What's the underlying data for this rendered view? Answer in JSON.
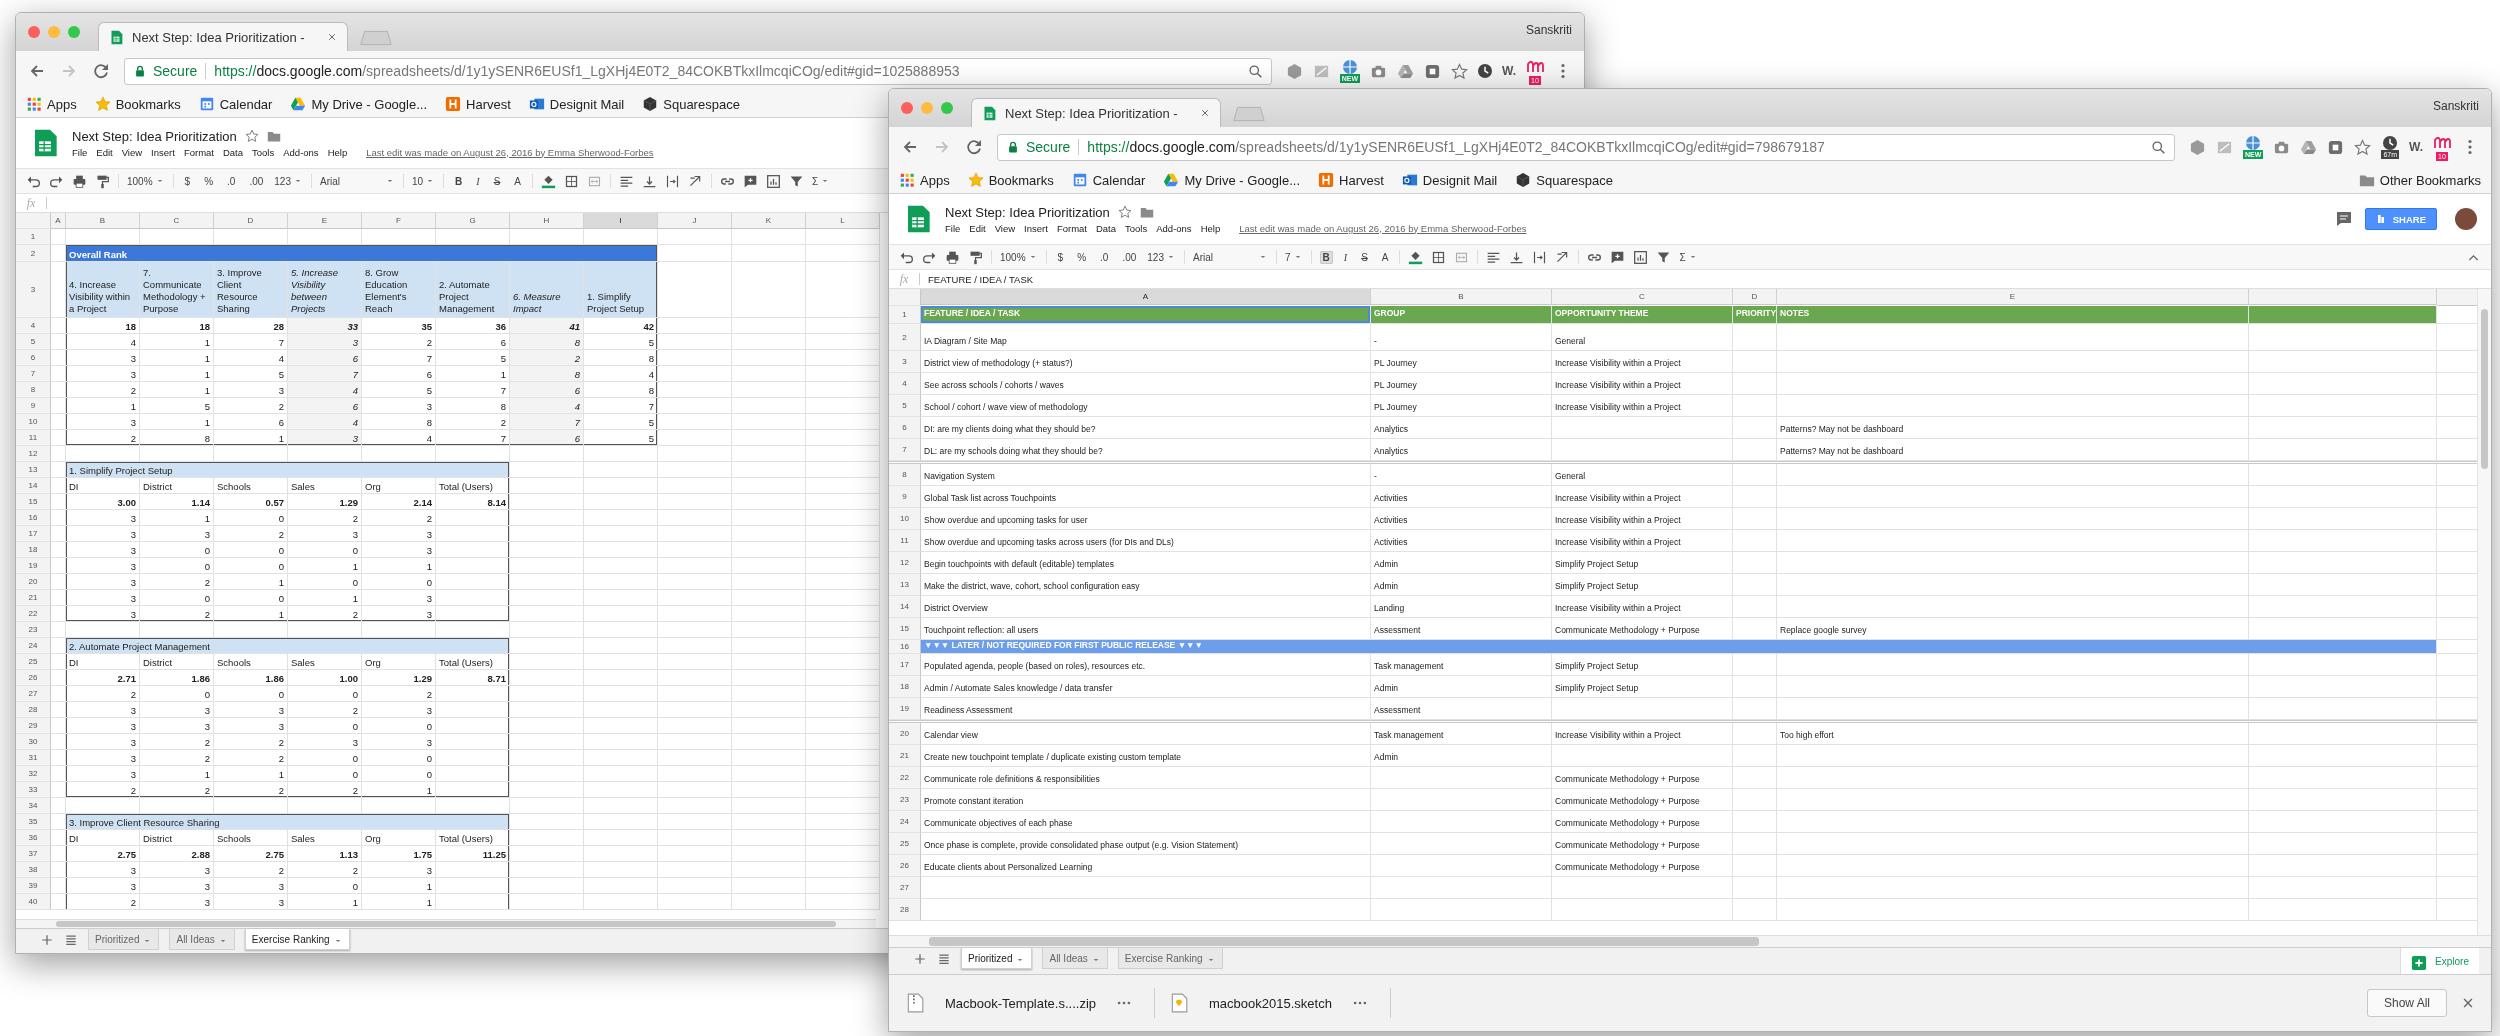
{
  "back_window": {
    "tab_title": "Next Step: Idea Prioritization -",
    "profile": "Sanskriti",
    "address": {
      "secure": "Secure",
      "scheme": "https://",
      "host": "docs.google.com",
      "path": "/spreadsheets/d/1y1ySENR6EUSf1_LgXHj4E0T2_84COKBTkxIlmcqiCOg/edit#gid=1025888953"
    },
    "extensions": {
      "new_badge": "NEW",
      "w_label": "W.",
      "m_badge": "10"
    },
    "bookmarks": [
      {
        "label": "Apps",
        "kind": "apps"
      },
      {
        "label": "Bookmarks",
        "kind": "star"
      },
      {
        "label": "Calendar",
        "kind": "calendar"
      },
      {
        "label": "My Drive - Google...",
        "kind": "drive"
      },
      {
        "label": "Harvest",
        "kind": "harvest"
      },
      {
        "label": "Designit Mail",
        "kind": "mail"
      },
      {
        "label": "Squarespace",
        "kind": "cube"
      }
    ],
    "doc": {
      "title": "Next Step: Idea Prioritization",
      "menus": [
        "File",
        "Edit",
        "View",
        "Insert",
        "Format",
        "Data",
        "Tools",
        "Add-ons",
        "Help"
      ],
      "last_edit": "Last edit was made on August 26, 2016 by Emma Sherwood-Forbes"
    },
    "toolbar": {
      "zoom": "100%",
      "currency": "$",
      "percent": "%",
      "decimals_less": ".0",
      "decimals_more": ".00",
      "number_format": "123",
      "font": "Arial",
      "font_size": "10",
      "bold": "B",
      "bold_active": false,
      "italic": "I",
      "strike": "S",
      "text_color": "A",
      "functions": "Σ"
    },
    "fx_label": "fx",
    "sheet": {
      "columns": [
        {
          "letter": "A",
          "selected": false
        },
        {
          "letter": "B",
          "selected": false
        },
        {
          "letter": "C",
          "selected": false
        },
        {
          "letter": "D",
          "selected": false
        },
        {
          "letter": "E",
          "selected": false
        },
        {
          "letter": "F",
          "selected": false
        },
        {
          "letter": "G",
          "selected": false
        },
        {
          "letter": "H",
          "selected": false
        },
        {
          "letter": "I",
          "selected": true
        },
        {
          "letter": "J",
          "selected": false
        },
        {
          "letter": "K",
          "selected": false
        },
        {
          "letter": "L",
          "selected": false
        }
      ],
      "row_numbers": [
        "1",
        "2",
        "3",
        "4",
        "5",
        "6",
        "7",
        "8",
        "9",
        "10",
        "11",
        "12",
        "13",
        "14",
        "15",
        "16",
        "17",
        "18",
        "19",
        "20",
        "21",
        "22",
        "23",
        "24",
        "25",
        "26",
        "27",
        "28",
        "29",
        "30",
        "31",
        "32",
        "33",
        "34",
        "35",
        "36",
        "37",
        "38",
        "39",
        "40"
      ],
      "rank_table": {
        "title": "Overall Rank",
        "columns": [
          {
            "heading": "4. Increase Visibility within a Project",
            "italic": false,
            "total": "18",
            "scores": [
              "4",
              "3",
              "3",
              "2",
              "1",
              "3",
              "2"
            ]
          },
          {
            "heading": "7. Communicate Methodology + Purpose",
            "italic": false,
            "total": "18",
            "scores": [
              "1",
              "1",
              "1",
              "1",
              "5",
              "1",
              "8"
            ]
          },
          {
            "heading": "3. Improve Client Resource Sharing",
            "italic": false,
            "total": "28",
            "scores": [
              "7",
              "4",
              "5",
              "3",
              "2",
              "6",
              "1"
            ]
          },
          {
            "heading": "5. Increase Visibility between Projects",
            "italic": true,
            "total": "33",
            "scores": [
              "3",
              "6",
              "7",
              "4",
              "6",
              "4",
              "3"
            ]
          },
          {
            "heading": "8. Grow Education Element's Reach",
            "italic": false,
            "total": "35",
            "scores": [
              "2",
              "7",
              "6",
              "5",
              "3",
              "8",
              "4"
            ]
          },
          {
            "heading": "2. Automate Project Management",
            "italic": false,
            "total": "36",
            "scores": [
              "6",
              "5",
              "1",
              "7",
              "8",
              "2",
              "7"
            ]
          },
          {
            "heading": "6. Measure Impact",
            "italic": true,
            "total": "41",
            "scores": [
              "8",
              "2",
              "8",
              "6",
              "4",
              "7",
              "6"
            ]
          },
          {
            "heading": "1. Simplify Project Setup",
            "italic": false,
            "total": "42",
            "scores": [
              "5",
              "8",
              "4",
              "8",
              "7",
              "5",
              "5"
            ]
          }
        ]
      },
      "group_tables": [
        {
          "title": "1. Simplify Project Setup",
          "headings": [
            "DI",
            "District",
            "Schools",
            "Sales",
            "Org",
            "Total (Users)"
          ],
          "averages": [
            "3.00",
            "1.14",
            "0.57",
            "1.29",
            "2.14",
            "8.14"
          ],
          "rows": [
            [
              "3",
              "1",
              "0",
              "2",
              "2"
            ],
            [
              "3",
              "3",
              "2",
              "3",
              "3"
            ],
            [
              "3",
              "0",
              "0",
              "0",
              "3"
            ],
            [
              "3",
              "0",
              "0",
              "1",
              "1"
            ],
            [
              "3",
              "2",
              "1",
              "0",
              "0"
            ],
            [
              "3",
              "0",
              "0",
              "1",
              "3"
            ],
            [
              "3",
              "2",
              "1",
              "2",
              "3"
            ]
          ]
        },
        {
          "title": "2. Automate Project Management",
          "headings": [
            "DI",
            "District",
            "Schools",
            "Sales",
            "Org",
            "Total (Users)"
          ],
          "averages": [
            "2.71",
            "1.86",
            "1.86",
            "1.00",
            "1.29",
            "8.71"
          ],
          "rows": [
            [
              "2",
              "0",
              "0",
              "0",
              "2"
            ],
            [
              "3",
              "3",
              "3",
              "2",
              "3"
            ],
            [
              "3",
              "3",
              "3",
              "0",
              "0"
            ],
            [
              "3",
              "2",
              "2",
              "3",
              "3"
            ],
            [
              "3",
              "2",
              "2",
              "0",
              "0"
            ],
            [
              "3",
              "1",
              "1",
              "0",
              "0"
            ],
            [
              "2",
              "2",
              "2",
              "2",
              "1"
            ]
          ]
        },
        {
          "title": "3. Improve Client Resource Sharing",
          "headings": [
            "DI",
            "District",
            "Schools",
            "Sales",
            "Org",
            "Total (Users)"
          ],
          "averages": [
            "2.75",
            "2.88",
            "2.75",
            "1.13",
            "1.75",
            "11.25"
          ],
          "rows": [
            [
              "3",
              "3",
              "2",
              "2",
              "3"
            ],
            [
              "3",
              "3",
              "3",
              "0",
              "1"
            ],
            [
              "2",
              "3",
              "3",
              "1",
              "1"
            ]
          ]
        }
      ]
    },
    "sheet_tabs": [
      {
        "label": "Prioritized",
        "selected": false
      },
      {
        "label": "All Ideas",
        "selected": false
      },
      {
        "label": "Exercise Ranking",
        "selected": true
      }
    ]
  },
  "front_window": {
    "tab_title": "Next Step: Idea Prioritization -",
    "profile": "Sanskriti",
    "address": {
      "secure": "Secure",
      "scheme": "https://",
      "host": "docs.google.com",
      "path": "/spreadsheets/d/1y1ySENR6EUSf1_LgXHj4E0T2_84COKBTkxIlmcqiCOg/edit#gid=798679187"
    },
    "extensions": {
      "new_badge": "NEW",
      "clock_badge": "67m",
      "w_label": "W.",
      "m_badge": "10"
    },
    "bookmarks": [
      {
        "label": "Apps",
        "kind": "apps"
      },
      {
        "label": "Bookmarks",
        "kind": "star"
      },
      {
        "label": "Calendar",
        "kind": "calendar"
      },
      {
        "label": "My Drive - Google...",
        "kind": "drive"
      },
      {
        "label": "Harvest",
        "kind": "harvest"
      },
      {
        "label": "Designit Mail",
        "kind": "mail"
      },
      {
        "label": "Squarespace",
        "kind": "cube"
      }
    ],
    "other_bookmarks": "Other Bookmarks",
    "doc": {
      "title": "Next Step: Idea Prioritization",
      "menus": [
        "File",
        "Edit",
        "View",
        "Insert",
        "Format",
        "Data",
        "Tools",
        "Add-ons",
        "Help"
      ],
      "last_edit": "Last edit was made on August 26, 2016 by Emma Sherwood-Forbes",
      "share": "SHARE"
    },
    "toolbar": {
      "zoom": "100%",
      "currency": "$",
      "percent": "%",
      "decimals_less": ".0",
      "decimals_more": ".00",
      "number_format": "123",
      "font": "Arial",
      "font_size": "7",
      "bold": "B",
      "bold_active": true,
      "italic": "I",
      "strike": "S",
      "text_color": "A",
      "functions": "Σ"
    },
    "fx_label": "fx",
    "formula": "FEATURE / IDEA / TASK",
    "sheet": {
      "columns": [
        {
          "letter": "A",
          "selected": true
        },
        {
          "letter": "B",
          "selected": false
        },
        {
          "letter": "C",
          "selected": false
        },
        {
          "letter": "D",
          "selected": false
        },
        {
          "letter": "E",
          "selected": false
        }
      ],
      "rows": [
        {
          "number": "1",
          "kind": "header",
          "section_start": false,
          "cells": [
            "FEATURE / IDEA / TASK",
            "GROUP",
            "OPPORTUNITY THEME",
            "PRIORITY",
            "NOTES"
          ]
        },
        {
          "number": "2",
          "kind": "item",
          "section_start": false,
          "task": "IA Diagram / Site Map",
          "group": "-",
          "theme": "General"
        },
        {
          "number": "3",
          "kind": "item",
          "section_start": false,
          "task": "District view of methodology (+ status?)",
          "group": "PL Journey",
          "theme": "Increase Visibility within a Project"
        },
        {
          "number": "4",
          "kind": "item",
          "section_start": false,
          "task": "See across schools / cohorts / waves",
          "group": "PL Journey",
          "theme": "Increase Visibility within a Project"
        },
        {
          "number": "5",
          "kind": "item",
          "section_start": false,
          "task": "School / cohort / wave view of methodology",
          "group": "PL Journey",
          "theme": "Increase Visibility within a Project"
        },
        {
          "number": "6",
          "kind": "item",
          "section_start": false,
          "task": "DI: are my clients doing what they should be?",
          "group": "Analytics",
          "notes": "Patterns? May not be dashboard"
        },
        {
          "number": "7",
          "kind": "item",
          "section_start": false,
          "task": "DL: are my schools doing what they should be?",
          "group": "Analytics",
          "notes": "Patterns? May not be dashboard"
        },
        {
          "number": "8",
          "kind": "item",
          "section_start": true,
          "task": "Navigation System",
          "group": "-",
          "theme": "General"
        },
        {
          "number": "9",
          "kind": "item",
          "section_start": false,
          "task": "Global Task list across Touchpoints",
          "group": "Activities",
          "theme": "Increase Visibility within a Project"
        },
        {
          "number": "10",
          "kind": "item",
          "section_start": false,
          "task": "Show overdue and upcoming tasks for user",
          "group": "Activities",
          "theme": "Increase Visibility within a Project"
        },
        {
          "number": "11",
          "kind": "item",
          "section_start": false,
          "task": "Show overdue and upcoming tasks across users (for DIs and DLs)",
          "group": "Activities",
          "theme": "Increase Visibility within a Project"
        },
        {
          "number": "12",
          "kind": "item",
          "section_start": false,
          "task": "Begin touchpoints with default (editable) templates",
          "group": "Admin",
          "theme": "Simplify Project Setup"
        },
        {
          "number": "13",
          "kind": "item",
          "section_start": false,
          "task": "Make the district, wave, cohort, school configuration easy",
          "group": "Admin",
          "theme": "Simplify Project Setup"
        },
        {
          "number": "14",
          "kind": "item",
          "section_start": false,
          "task": "District Overview",
          "group": "Landing",
          "theme": "Increase Visibility within a Project"
        },
        {
          "number": "15",
          "kind": "item",
          "section_start": false,
          "task": "Touchpoint reflection: all users",
          "group": "Assessment",
          "theme": "Communicate Methodology + Purpose",
          "notes": "Replace google survey"
        },
        {
          "number": "16",
          "kind": "banner",
          "section_start": false,
          "text": "▼▼▼ LATER / NOT REQUIRED FOR FIRST PUBLIC RELEASE ▼▼▼"
        },
        {
          "number": "17",
          "kind": "item",
          "section_start": false,
          "task": "Populated agenda, people (based on roles), resources etc.",
          "group": "Task management",
          "theme": "Simplify Project Setup"
        },
        {
          "number": "18",
          "kind": "item",
          "section_start": false,
          "task": "Admin / Automate Sales knowledge / data transfer",
          "group": "Admin",
          "theme": "Simplify Project Setup"
        },
        {
          "number": "19",
          "kind": "item",
          "section_start": false,
          "task": "Readiness Assessment",
          "group": "Assessment"
        },
        {
          "number": "20",
          "kind": "item",
          "section_start": true,
          "task": "Calendar view",
          "group": "Task management",
          "theme": "Increase Visibility within a Project",
          "notes": "Too high effort"
        },
        {
          "number": "21",
          "kind": "item",
          "section_start": false,
          "task": "Create new touchpoint template / duplicate existing custom template",
          "group": "Admin"
        },
        {
          "number": "22",
          "kind": "item",
          "section_start": false,
          "task": "Communicate role definitions & responsibilities",
          "theme": "Communicate Methodology + Purpose"
        },
        {
          "number": "23",
          "kind": "item",
          "section_start": false,
          "task": "Promote constant iteration",
          "theme": "Communicate Methodology + Purpose"
        },
        {
          "number": "24",
          "kind": "item",
          "section_start": false,
          "task": "Communicate objectives of each phase",
          "theme": "Communicate Methodology + Purpose"
        },
        {
          "number": "25",
          "kind": "item",
          "section_start": false,
          "task": "Once phase is complete, provide consolidated phase output (e.g. Vision Statement)",
          "theme": "Communicate Methodology + Purpose"
        },
        {
          "number": "26",
          "kind": "item",
          "section_start": false,
          "task": "Educate clients about Personalized Learning",
          "theme": "Communicate Methodology + Purpose"
        },
        {
          "number": "27",
          "kind": "empty",
          "section_start": false
        },
        {
          "number": "28",
          "kind": "empty",
          "section_start": false
        }
      ]
    },
    "sheet_tabs": [
      {
        "label": "Prioritized",
        "selected": true
      },
      {
        "label": "All Ideas",
        "selected": false
      },
      {
        "label": "Exercise Ranking",
        "selected": false
      }
    ],
    "explore": "Explore",
    "downloads": {
      "files": [
        {
          "name": "Macbook-Template.s....zip",
          "kind": "zip"
        },
        {
          "name": "macbook2015.sketch",
          "kind": "sketch"
        }
      ],
      "show_all": "Show All"
    }
  }
}
